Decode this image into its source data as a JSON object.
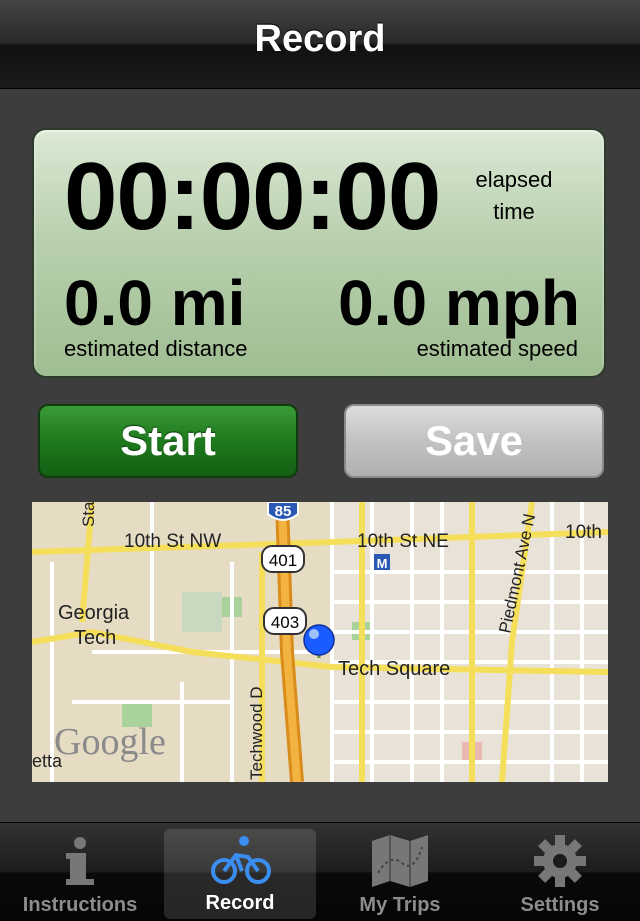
{
  "navbar": {
    "title": "Record"
  },
  "stats": {
    "timer": "00:00:00",
    "elapsed_line1": "elapsed",
    "elapsed_line2": "time",
    "distance_value": "0.0 mi",
    "distance_label": "estimated distance",
    "speed_value": "0.0 mph",
    "speed_label": "estimated speed"
  },
  "buttons": {
    "start": "Start",
    "save": "Save"
  },
  "map": {
    "labels": {
      "state": "Stat",
      "tenth_nw": "10th St NW",
      "tenth_ne": "10th St NE",
      "tenth_right": "10th",
      "georgia": "Georgia",
      "tech": "Tech",
      "tech_square": "Tech Square",
      "techwood": "Techwood D",
      "piedmont": "Piedmont Ave N",
      "route_401": "401",
      "route_403": "403",
      "interstate": "85",
      "metro": "M",
      "google": "Google",
      "etta": "etta"
    }
  },
  "tabs": [
    {
      "label": "Instructions",
      "icon": "info-icon"
    },
    {
      "label": "Record",
      "icon": "bicycle-icon"
    },
    {
      "label": "My Trips",
      "icon": "map-icon"
    },
    {
      "label": "Settings",
      "icon": "gear-icon"
    }
  ],
  "colors": {
    "accent_green": "#1f7a1e",
    "panel_green": "#b8d0ae",
    "location_blue": "#1a5cff"
  }
}
